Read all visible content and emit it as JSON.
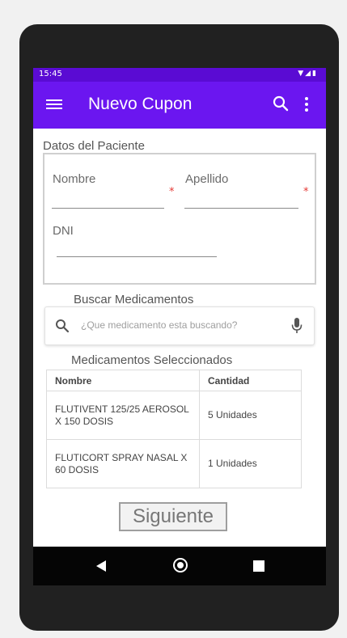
{
  "status_bar": {
    "time": "15:45",
    "icons": [
      "wifi-icon",
      "signal-icon",
      "battery-icon"
    ]
  },
  "app_bar": {
    "title": "Nuevo Cupon",
    "background": "#6b16f0",
    "status_background": "#5a0bd3",
    "icons": [
      "menu-icon",
      "search-icon",
      "more-vert-icon"
    ]
  },
  "patient": {
    "section_title": "Datos del Paciente",
    "fields": {
      "nombre": {
        "label": "Nombre",
        "value": "",
        "required": "*"
      },
      "apellido": {
        "label": "Apellido",
        "value": "",
        "required": "*"
      },
      "dni": {
        "label": "DNI",
        "value": ""
      }
    }
  },
  "search": {
    "section_title": "Buscar Medicamentos",
    "placeholder": "¿Que medicamento esta buscando?",
    "value": ""
  },
  "selected": {
    "section_title": "Medicamentos Seleccionados",
    "columns": [
      "Nombre",
      "Cantidad"
    ],
    "rows": [
      {
        "name": "FLUTIVENT 125/25 AEROSOL X 150 DOSIS",
        "quantity": "5 Unidades"
      },
      {
        "name": "FLUTICORT SPRAY NASAL X 60 DOSIS",
        "quantity": "1 Unidades"
      }
    ]
  },
  "actions": {
    "next_label": "Siguiente"
  },
  "nav_bar": {
    "icons": [
      "back-icon",
      "home-icon",
      "recents-icon"
    ]
  }
}
